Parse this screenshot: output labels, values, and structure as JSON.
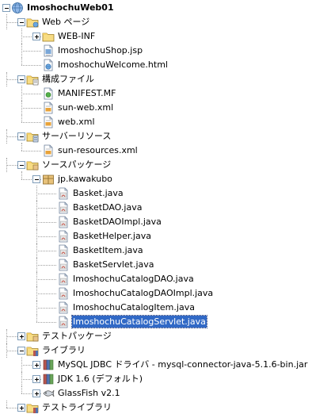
{
  "tree": [
    {
      "label": "ImoshochuWeb01",
      "icon": "globe-project-icon",
      "expanded": true,
      "bold": true
    },
    {
      "label": "Web ページ",
      "icon": "web-folder-icon",
      "expanded": true
    },
    {
      "label": "WEB-INF",
      "icon": "folder-icon",
      "expanded": false
    },
    {
      "label": "ImoshochuShop.jsp",
      "icon": "jsp-file-icon"
    },
    {
      "label": "ImoshochuWelcome.html",
      "icon": "html-file-icon"
    },
    {
      "label": "構成ファイル",
      "icon": "config-folder-icon",
      "expanded": true
    },
    {
      "label": "MANIFEST.MF",
      "icon": "manifest-file-icon"
    },
    {
      "label": "sun-web.xml",
      "icon": "xml-file-icon"
    },
    {
      "label": "web.xml",
      "icon": "xml-file-icon"
    },
    {
      "label": "サーバーリソース",
      "icon": "server-resources-folder-icon",
      "expanded": true
    },
    {
      "label": "sun-resources.xml",
      "icon": "xml-file-icon"
    },
    {
      "label": "ソースパッケージ",
      "icon": "source-packages-folder-icon",
      "expanded": true
    },
    {
      "label": "jp.kawakubo",
      "icon": "package-icon",
      "expanded": true
    },
    {
      "label": "Basket.java",
      "icon": "java-file-icon"
    },
    {
      "label": "BasketDAO.java",
      "icon": "java-file-icon"
    },
    {
      "label": "BasketDAOImpl.java",
      "icon": "java-file-icon"
    },
    {
      "label": "BasketHelper.java",
      "icon": "java-file-icon"
    },
    {
      "label": "BasketItem.java",
      "icon": "java-file-icon"
    },
    {
      "label": "BasketServlet.java",
      "icon": "java-file-icon"
    },
    {
      "label": "ImoshochuCatalogDAO.java",
      "icon": "java-file-icon"
    },
    {
      "label": "ImoshochuCatalogDAOImpl.java",
      "icon": "java-file-icon"
    },
    {
      "label": "ImoshochuCatalogItem.java",
      "icon": "java-file-icon"
    },
    {
      "label": "ImoshochuCatalogServlet.java",
      "icon": "java-file-icon",
      "selected": true
    },
    {
      "label": "テストパッケージ",
      "icon": "test-packages-folder-icon",
      "expanded": false
    },
    {
      "label": "ライブラリ",
      "icon": "libraries-folder-icon",
      "expanded": true
    },
    {
      "label": "MySQL JDBC ドライバ - mysql-connector-java-5.1.6-bin.jar",
      "icon": "jar-library-icon",
      "expanded": false
    },
    {
      "label": "JDK 1.6 (デフォルト)",
      "icon": "jdk-library-icon",
      "expanded": false
    },
    {
      "label": "GlassFish v2.1",
      "icon": "glassfish-icon",
      "expanded": false
    },
    {
      "label": "テストライブラリ",
      "icon": "test-libraries-folder-icon",
      "expanded": false
    }
  ]
}
